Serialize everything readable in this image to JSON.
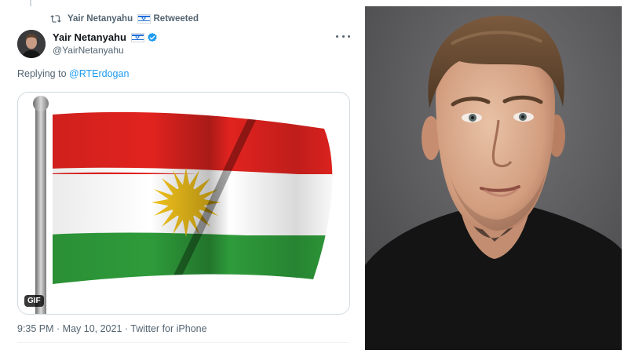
{
  "retweet": {
    "icon": "retweet-icon",
    "by": "Yair Netanyahu",
    "label": "Retweeted"
  },
  "author": {
    "name": "Yair Netanyahu",
    "handle": "@YairNetanyahu",
    "verified": true,
    "name_flag_icon": "israel-flag-icon"
  },
  "reply": {
    "prefix": "Replying to ",
    "target": "@RTErdogan"
  },
  "media": {
    "badge": "GIF",
    "description_icon": "kurdistan-flag-gif",
    "colors": {
      "red": "#e1231f",
      "white": "#ffffff",
      "green": "#2e9b3a",
      "sun": "#f2c21b"
    }
  },
  "timestamp": "9:35 PM · May 10, 2021 · Twitter for iPhone",
  "colors": {
    "link": "#1d9bf0",
    "secondary_text": "#536471",
    "verified": "#1d9bf0"
  }
}
